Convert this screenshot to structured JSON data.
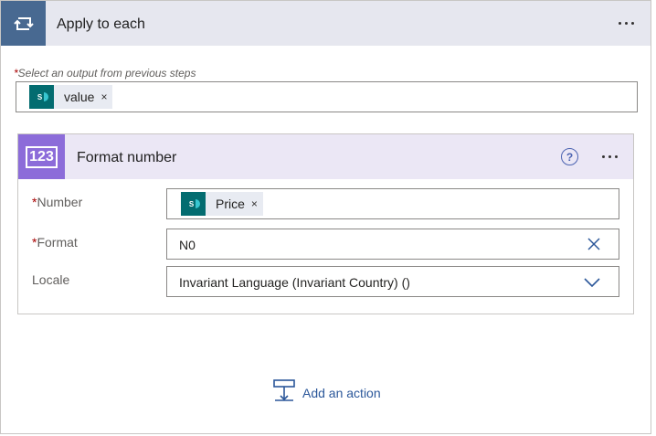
{
  "loop": {
    "title": "Apply to each",
    "select_required": "*",
    "select_label": "Select an output from previous steps",
    "token": {
      "icon": "sharepoint-icon",
      "label": "value",
      "remove": "×"
    }
  },
  "action": {
    "badge": "123",
    "title": "Format number",
    "help": "?",
    "fields": {
      "number": {
        "required": "*",
        "label": "Number",
        "token": {
          "icon": "sharepoint-icon",
          "label": "Price",
          "remove": "×"
        }
      },
      "format": {
        "required": "*",
        "label": "Format",
        "value": "N0"
      },
      "locale": {
        "label": "Locale",
        "value": "Invariant Language (Invariant Country) ()"
      }
    }
  },
  "add_action": {
    "label": "Add an action"
  },
  "colors": {
    "loop_icon_bg": "#486991",
    "action_accent": "#8c6cd9",
    "sharepoint": "#036c70",
    "link": "#2b579a"
  }
}
